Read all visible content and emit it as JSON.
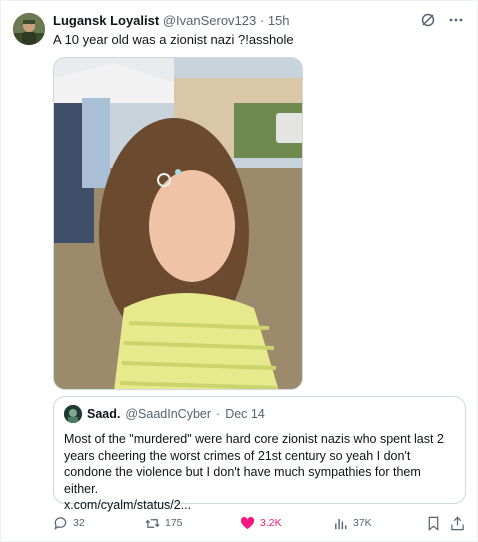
{
  "author": {
    "name": "Lugansk Loyalist",
    "handle": "@IvanSerov123",
    "separator": "·",
    "time": "15h"
  },
  "tweet": {
    "text": "A 10 year old was a zionist nazi ?!asshole"
  },
  "quote": {
    "name": "Saad.",
    "handle": "@SaadInCyber",
    "separator": "·",
    "date": "Dec 14",
    "text": "Most of the \"murdered\" were hard core zionist nazis who spent last 2 years cheering the worst crimes of 21st century so yeah I don't condone the violence but I don't have much sympathies for them either.",
    "link": "x.com/cyalm/status/2..."
  },
  "actions": {
    "replies": "32",
    "reposts": "175",
    "likes": "3.2K",
    "views": "37K"
  },
  "colors": {
    "like_active": "#f91880",
    "muted": "#536471",
    "border": "#cfd9de"
  },
  "icons": [
    "grok-icon",
    "more-icon",
    "reply-icon",
    "repost-icon",
    "heart-icon",
    "views-icon",
    "bookmark-icon",
    "share-icon"
  ]
}
